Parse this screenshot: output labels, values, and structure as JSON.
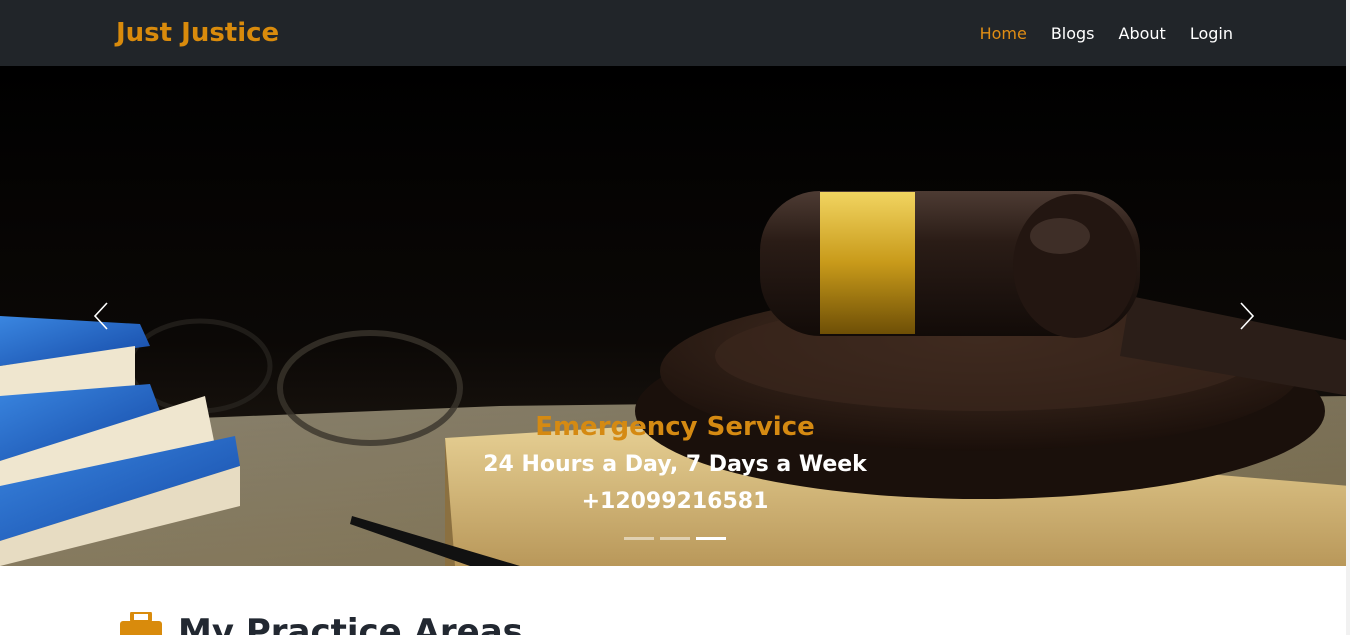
{
  "navbar": {
    "brand": "Just Justice",
    "links": [
      {
        "label": "Home"
      },
      {
        "label": "Blogs"
      },
      {
        "label": "About"
      },
      {
        "label": "Login"
      }
    ]
  },
  "hero": {
    "title": "Emergency Service",
    "subtitle": "24 Hours a Day, 7 Days a Week",
    "phone": "+12099216581",
    "slide_count": 3,
    "active_slide": 3,
    "icons": {
      "prev": "chevron-left-icon",
      "next": "chevron-right-icon"
    }
  },
  "section": {
    "icon": "briefcase-icon",
    "title": "My Practice Areas"
  },
  "colors": {
    "navbar_bg": "#212529",
    "accent": "#d98b0c",
    "nav_text": "#ffffff"
  }
}
